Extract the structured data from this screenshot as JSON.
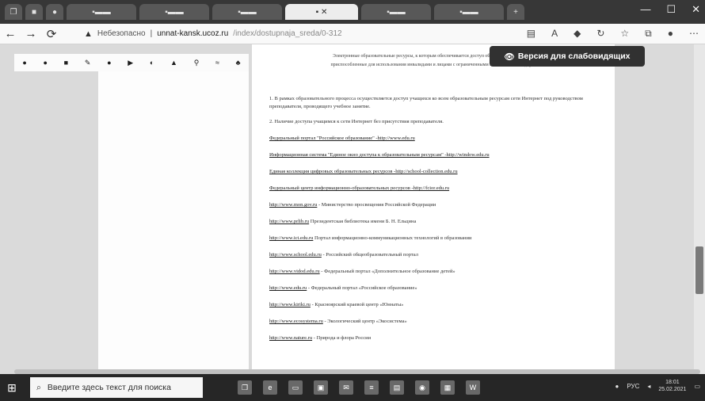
{
  "browser": {
    "url_security": "Небезопасно",
    "url_host": "unnat-kansk.ucoz.ru",
    "url_path": "/index/dostupnaja_sreda/0-312"
  },
  "window_controls": {
    "minimize": "—",
    "maximize": "☐",
    "close": "✕"
  },
  "nav": {
    "back": "←",
    "forward": "→",
    "reload": "⟳"
  },
  "accessibility": {
    "label": "Версия для слабовидящих",
    "icon": "eye-icon"
  },
  "content": {
    "header_line1": "Электронные образовательные ресурсы, к которым обеспечивается доступ обучающихся, в том числе",
    "header_line2": "приспособленные для использования инвалидами и лицами с ограниченными возможностями здоровья",
    "para1": "1. В рамках образовательного процесса осуществляется доступ учащихся ко всем образовательным ресурсам сети Интернет под руководством преподавателя, проводящего учебное занятие.",
    "para2": "2. Наличие доступа учащимся к сети Интернет без присутствия преподавателя.",
    "links": [
      "Федеральный портал \"Российское образование\" -http://www.edu.ru",
      "Информационная система \"Единое окно доступа к образовательным ресурсам\" -http://window.edu.ru",
      "Единая коллекция цифровых образовательных ресурсов -http://school-collection.edu.ru",
      "Федеральный центр информационно-образовательных ресурсов -http://fcior.edu.ru"
    ],
    "list": [
      {
        "link": "http://www.mon.gov.ru",
        "text": "- Министерство просвещения Российской Федерации"
      },
      {
        "link": "http://www.prlib.ru",
        "text": "Президентская библиотека имени Б. Н. Ельцина"
      },
      {
        "link": "http://www.ict.edu.ru",
        "text": "Портал информационно-коммуникационных технологий в образовании"
      },
      {
        "link": "http://www.school.edu.ru",
        "text": "- Российский общеобразовательный портал"
      },
      {
        "link": "http://www.vidod.edu.ru",
        "text": "- Федеральный портал «Дополнительное образование детей»"
      },
      {
        "link": "http://www.edu.ru",
        "text": "- Федеральный портал «Российское образование»"
      },
      {
        "link": "http://www.kiriki.ru",
        "text": "- Красноярский краевой центр «Юннаты»"
      },
      {
        "link": "http://www.ecosystema.ru",
        "text": "- Экологический центр «Экосистема»"
      },
      {
        "link": "http://www.nature.ru",
        "text": "- Природа и флора России"
      }
    ]
  },
  "taskbar": {
    "search_placeholder": "Введите здесь текст для поиска",
    "lang": "РУС",
    "time": "18:01",
    "date": "25.02.2021"
  }
}
